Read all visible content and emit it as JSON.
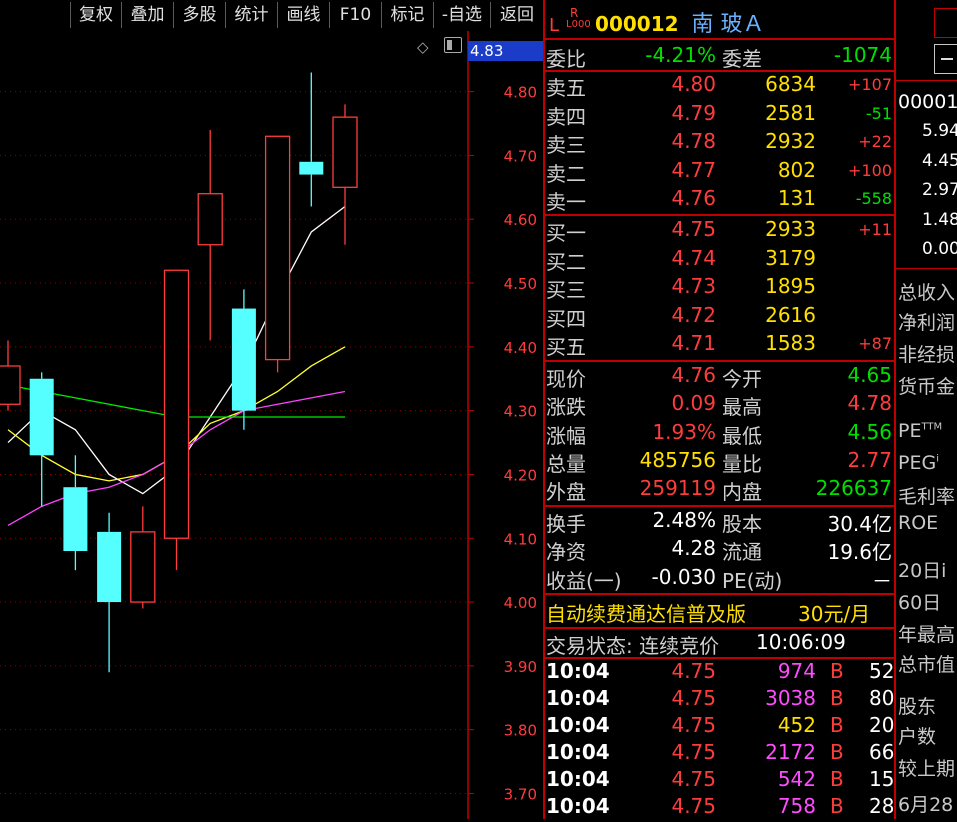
{
  "toolbar": {
    "buttons": [
      "复权",
      "叠加",
      "多股",
      "统计",
      "画线",
      "F10",
      "标记",
      "-自选",
      "返回"
    ]
  },
  "stock": {
    "l_mark": "L",
    "r_mark": "R",
    "r_sub": "L000",
    "code": "000012",
    "name": "南 玻Ａ"
  },
  "chart": {
    "current_price_tag": "4.83",
    "price_axis": [
      "4.80",
      "4.70",
      "4.60",
      "4.50",
      "4.40",
      "4.30",
      "4.20",
      "4.10",
      "4.00",
      "3.90",
      "3.80",
      "3.70"
    ],
    "y_range": [
      3.66,
      4.895
    ],
    "candles": [
      {
        "o": 4.31,
        "c": 4.37,
        "h": 4.41,
        "l": 4.3,
        "color": "red"
      },
      {
        "o": 4.35,
        "c": 4.23,
        "h": 4.36,
        "l": 4.15,
        "color": "cyan"
      },
      {
        "o": 4.18,
        "c": 4.08,
        "h": 4.23,
        "l": 4.05,
        "color": "cyan"
      },
      {
        "o": 4.11,
        "c": 4.0,
        "h": 4.14,
        "l": 3.89,
        "color": "cyan"
      },
      {
        "o": 4.0,
        "c": 4.11,
        "h": 4.15,
        "l": 3.99,
        "color": "red"
      },
      {
        "o": 4.1,
        "c": 4.52,
        "h": 4.52,
        "l": 4.05,
        "color": "red"
      },
      {
        "o": 4.56,
        "c": 4.64,
        "h": 4.74,
        "l": 4.41,
        "color": "red"
      },
      {
        "o": 4.46,
        "c": 4.3,
        "h": 4.49,
        "l": 4.27,
        "color": "cyan"
      },
      {
        "o": 4.38,
        "c": 4.73,
        "h": 4.73,
        "l": 4.36,
        "color": "red"
      },
      {
        "o": 4.69,
        "c": 4.67,
        "h": 4.83,
        "l": 4.62,
        "color": "cyan"
      },
      {
        "o": 4.65,
        "c": 4.76,
        "h": 4.78,
        "l": 4.56,
        "color": "red"
      }
    ],
    "ma_lines": [
      {
        "color": "#ffffff",
        "values": [
          4.25,
          4.3,
          4.27,
          4.2,
          4.17,
          4.21,
          4.29,
          4.37,
          4.48,
          4.58,
          4.62
        ]
      },
      {
        "color": "#ffff33",
        "values": [
          4.27,
          4.23,
          4.2,
          4.19,
          4.2,
          4.23,
          4.28,
          4.3,
          4.33,
          4.37,
          4.4
        ]
      },
      {
        "color": "#ff44ff",
        "values": [
          4.12,
          4.15,
          4.17,
          4.18,
          4.2,
          4.23,
          4.27,
          4.3,
          4.31,
          4.32,
          4.33
        ]
      },
      {
        "color": "#00ee00",
        "values": [
          4.34,
          4.33,
          4.32,
          4.31,
          4.3,
          4.29,
          4.29,
          4.29,
          4.29,
          4.29,
          4.29
        ]
      }
    ]
  },
  "weibi": {
    "label1": "委比",
    "value1": "-4.21%",
    "label2": "委差",
    "value2": "-1074"
  },
  "sell": [
    {
      "label": "卖五",
      "price": "4.80",
      "vol": "6834",
      "chg": "+107",
      "chg_color": "red"
    },
    {
      "label": "卖四",
      "price": "4.79",
      "vol": "2581",
      "chg": "-51",
      "chg_color": "green"
    },
    {
      "label": "卖三",
      "price": "4.78",
      "vol": "2932",
      "chg": "+22",
      "chg_color": "red"
    },
    {
      "label": "卖二",
      "price": "4.77",
      "vol": "802",
      "chg": "+100",
      "chg_color": "red"
    },
    {
      "label": "卖一",
      "price": "4.76",
      "vol": "131",
      "chg": "-558",
      "chg_color": "green"
    }
  ],
  "buy": [
    {
      "label": "买一",
      "price": "4.75",
      "vol": "2933",
      "chg": "+11",
      "chg_color": "red"
    },
    {
      "label": "买二",
      "price": "4.74",
      "vol": "3179",
      "chg": "",
      "chg_color": "red"
    },
    {
      "label": "买三",
      "price": "4.73",
      "vol": "1895",
      "chg": "",
      "chg_color": "red"
    },
    {
      "label": "买四",
      "price": "4.72",
      "vol": "2616",
      "chg": "",
      "chg_color": "red"
    },
    {
      "label": "买五",
      "price": "4.71",
      "vol": "1583",
      "chg": "+87",
      "chg_color": "red"
    }
  ],
  "quote": [
    {
      "l1": "现价",
      "v1": "4.76",
      "c1": "red",
      "l2": "今开",
      "v2": "4.65",
      "c2": "green"
    },
    {
      "l1": "涨跌",
      "v1": "0.09",
      "c1": "red",
      "l2": "最高",
      "v2": "4.78",
      "c2": "red"
    },
    {
      "l1": "涨幅",
      "v1": "1.93%",
      "c1": "red",
      "l2": "最低",
      "v2": "4.56",
      "c2": "green"
    },
    {
      "l1": "总量",
      "v1": "485756",
      "c1": "yellow",
      "l2": "量比",
      "v2": "2.77",
      "c2": "red"
    },
    {
      "l1": "外盘",
      "v1": "259119",
      "c1": "red",
      "l2": "内盘",
      "v2": "226637",
      "c2": "green"
    }
  ],
  "fundamentals": [
    {
      "l1": "换手",
      "v1": "2.48%",
      "l2": "股本",
      "v2": "30.4亿"
    },
    {
      "l1": "净资",
      "v1": "4.28",
      "l2": "流通",
      "v2": "19.6亿"
    },
    {
      "l1": "收益(一)",
      "v1": "-0.030",
      "l2": "PE(动)",
      "v2": "－"
    }
  ],
  "promo": {
    "text": "自动续费通达信普及版",
    "price": "30元/月"
  },
  "trade_status": {
    "label": "交易状态: 连续竞价",
    "time": "10:06:09"
  },
  "ticks": [
    {
      "time": "10:04",
      "price": "4.75",
      "vol": "974",
      "vol_color": "magenta",
      "side": "B",
      "n": "52"
    },
    {
      "time": "10:04",
      "price": "4.75",
      "vol": "3038",
      "vol_color": "magenta",
      "side": "B",
      "n": "80"
    },
    {
      "time": "10:04",
      "price": "4.75",
      "vol": "452",
      "vol_color": "yellow",
      "side": "B",
      "n": "20"
    },
    {
      "time": "10:04",
      "price": "4.75",
      "vol": "2172",
      "vol_color": "magenta",
      "side": "B",
      "n": "66"
    },
    {
      "time": "10:04",
      "price": "4.75",
      "vol": "542",
      "vol_color": "magenta",
      "side": "B",
      "n": "15"
    },
    {
      "time": "10:04",
      "price": "4.75",
      "vol": "758",
      "vol_color": "magenta",
      "side": "B",
      "n": "28"
    }
  ],
  "far_right": {
    "code": "00001",
    "values": [
      "5.94",
      "4.45",
      "2.97",
      "1.48",
      "0.00"
    ],
    "labels": [
      "总收入",
      "净利润",
      "非经损",
      "货币金",
      "PE",
      "PEG",
      "毛利率",
      "ROE",
      "20日i",
      "60日",
      "年最高",
      "总市值",
      "股东",
      "户数",
      "较上期",
      "6月28"
    ],
    "pe_sup": "TTM",
    "peg_sup": "i"
  }
}
